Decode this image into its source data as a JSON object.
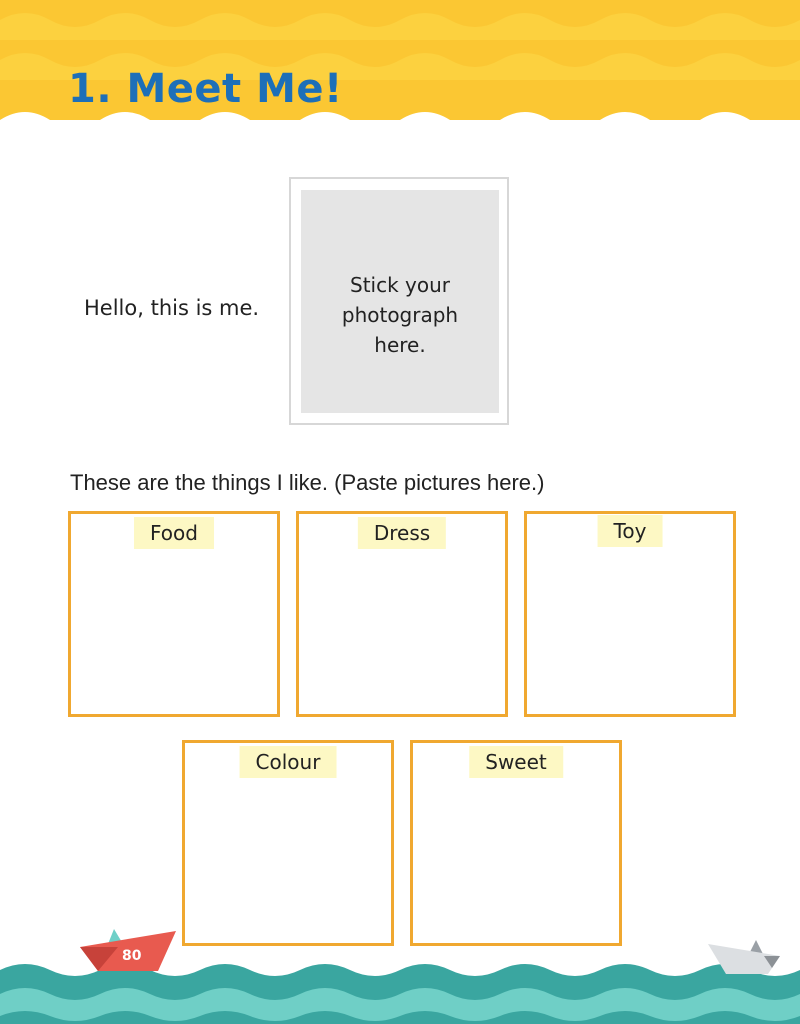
{
  "header": {
    "title": "1. Meet Me!"
  },
  "intro": {
    "text": "Hello, this is me.",
    "photo_placeholder": "Stick your\nphotograph\nhere."
  },
  "likes": {
    "instruction": "These are the things I like. (Paste pictures here.)",
    "boxes": [
      {
        "label": "Food"
      },
      {
        "label": "Dress"
      },
      {
        "label": "Toy"
      },
      {
        "label": "Colour"
      },
      {
        "label": "Sweet"
      }
    ]
  },
  "footer": {
    "page_number": "80"
  },
  "colors": {
    "header_yellow": "#fbc733",
    "title_blue": "#1d6fb8",
    "box_border": "#f0a830",
    "label_bg": "#fdf8c4",
    "wave_teal": "#3aa6a0"
  }
}
